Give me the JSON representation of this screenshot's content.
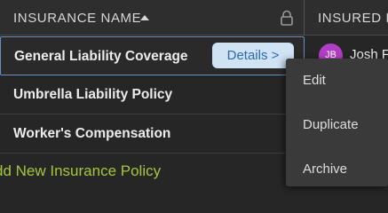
{
  "header": {
    "name_column": "INSURANCE NAME",
    "insured_column": "INSURED R"
  },
  "rows": [
    {
      "name": "General Liability Coverage",
      "details_label": "Details >"
    },
    {
      "name": "Umbrella Liability Policy"
    },
    {
      "name": "Worker's Compensation"
    }
  ],
  "insured": {
    "initials": "JB",
    "name": "Josh F"
  },
  "add_policy_label": "dd New Insurance Policy",
  "context_menu": {
    "items": [
      "Edit",
      "Duplicate",
      "Archive"
    ]
  },
  "colors": {
    "background": "#262626",
    "details_button_bg": "#cfe3f5",
    "details_button_text": "#2f6aa8",
    "add_link": "#a3c63a",
    "avatar": "#b03ec4",
    "selected_row_border": "#6b8fbf"
  },
  "icons": {
    "sort": "sort-ascending-icon",
    "lock": "lock-icon"
  }
}
